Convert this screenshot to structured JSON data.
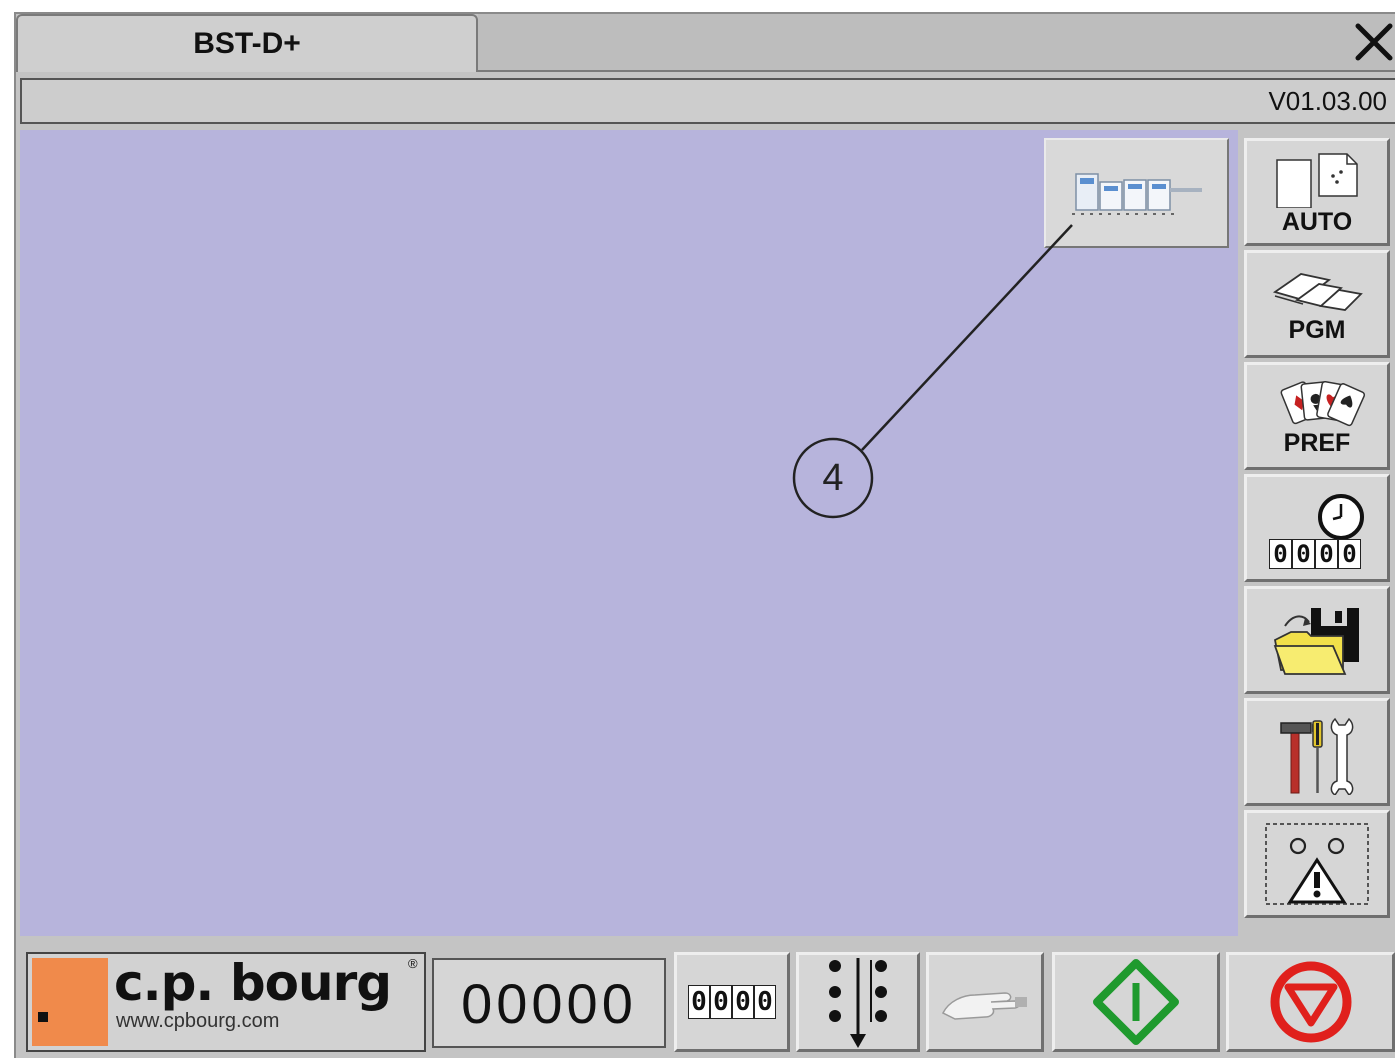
{
  "window": {
    "tab_title": "BST-D+",
    "version": "V01.03.00"
  },
  "callout": {
    "number": "4"
  },
  "sidebar": {
    "items": [
      {
        "label": "AUTO",
        "icon": "auto-docs-icon"
      },
      {
        "label": "PGM",
        "icon": "pgm-sheets-icon"
      },
      {
        "label": "PREF",
        "icon": "pref-cards-icon"
      },
      {
        "label": "",
        "icon": "counter-timer-icon",
        "digits": "0000"
      },
      {
        "label": "",
        "icon": "folder-save-icon"
      },
      {
        "label": "",
        "icon": "tools-icon"
      },
      {
        "label": "",
        "icon": "warning-alarm-icon"
      }
    ]
  },
  "bottom": {
    "logo_text": "c.p. bourg",
    "logo_url": "www.cpbourg.com",
    "logo_reg": "®",
    "counter_value": "00000",
    "small_counter": "0000",
    "colors": {
      "start_green": "#1f9a2e",
      "stop_red": "#e0201c",
      "logo_orange": "#f08a4b",
      "main_bg": "#b7b4dc"
    }
  }
}
